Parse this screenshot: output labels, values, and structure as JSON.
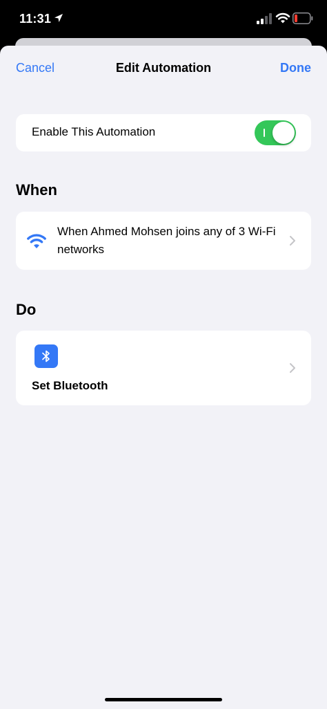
{
  "status_bar": {
    "time": "11:31",
    "icons": [
      "location-arrow-icon",
      "cellular-signal-icon",
      "wifi-icon",
      "battery-low-icon"
    ],
    "battery_color": "#ff3b30"
  },
  "nav": {
    "cancel_label": "Cancel",
    "title": "Edit Automation",
    "done_label": "Done"
  },
  "enable": {
    "label": "Enable This Automation",
    "enabled": true
  },
  "when": {
    "header": "When",
    "trigger_text": "When Ahmed Mohsen joins any of 3 Wi-Fi networks",
    "icon": "wifi-icon"
  },
  "do": {
    "header": "Do",
    "action_label": "Set Bluetooth",
    "icon": "bluetooth-icon"
  },
  "colors": {
    "accent": "#3478f6",
    "toggle_on": "#34c759",
    "background": "#f2f2f7"
  }
}
